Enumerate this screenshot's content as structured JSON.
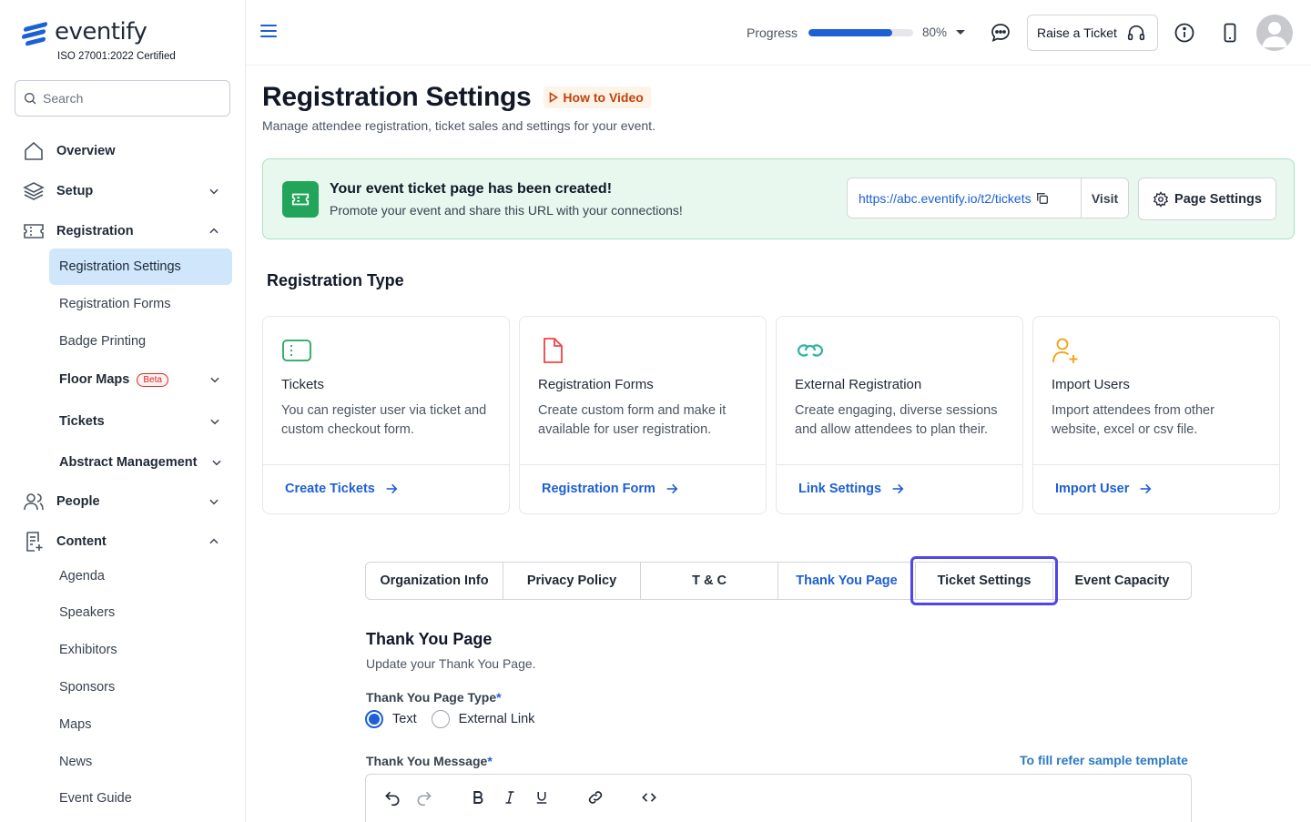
{
  "app": {
    "logo_text": "eventify",
    "certification": "ISO 27001:2022 Certified"
  },
  "search": {
    "placeholder": "Search"
  },
  "sidebar": {
    "items": [
      {
        "label": "Overview",
        "icon": "home-icon"
      },
      {
        "label": "Setup",
        "icon": "layers-icon",
        "expanded": false
      },
      {
        "label": "Registration",
        "icon": "ticket-icon",
        "expanded": true
      },
      {
        "label": "People",
        "icon": "users-icon",
        "expanded": false
      },
      {
        "label": "Content",
        "icon": "document-icon",
        "expanded": true
      }
    ],
    "registration_sub": [
      {
        "label": "Registration Settings",
        "active": true
      },
      {
        "label": "Registration Forms"
      },
      {
        "label": "Badge Printing"
      },
      {
        "label": "Floor Maps",
        "badge": "Beta"
      },
      {
        "label": "Tickets"
      },
      {
        "label": "Abstract Management"
      }
    ],
    "content_sub": [
      {
        "label": "Agenda"
      },
      {
        "label": "Speakers"
      },
      {
        "label": "Exhibitors"
      },
      {
        "label": "Sponsors"
      },
      {
        "label": "Maps"
      },
      {
        "label": "News"
      },
      {
        "label": "Event Guide"
      }
    ]
  },
  "header": {
    "progress_label": "Progress",
    "progress_value": 0.8,
    "progress_text": "80%",
    "raise_ticket_label": "Raise a Ticket"
  },
  "page": {
    "title": "Registration Settings",
    "how_to_video": "How to Video",
    "subtitle": "Manage attendee registration, ticket sales and settings for your event."
  },
  "banner": {
    "title": "Your event ticket page has been created!",
    "subtitle": "Promote your event and share this URL with your connections!",
    "url": "https://abc.eventify.io/t2/tickets",
    "visit_label": "Visit",
    "page_settings_label": "Page Settings"
  },
  "registration_type": {
    "title": "Registration Type",
    "cards": [
      {
        "title": "Tickets",
        "description": "You can register user via ticket and custom checkout form.",
        "link": "Create Tickets",
        "icon": "ticket-icon"
      },
      {
        "title": "Registration Forms",
        "description": "Create custom form and make it available for user registration.",
        "link": "Registration Form",
        "icon": "file-icon"
      },
      {
        "title": "External Registration",
        "description": "Create engaging, diverse sessions and allow attendees to plan their.",
        "link": "Link Settings",
        "icon": "link-icon"
      },
      {
        "title": "Import Users",
        "description": "Import attendees from other website, excel or csv file.",
        "link": "Import User",
        "icon": "user-plus-icon"
      }
    ]
  },
  "tabs": [
    {
      "label": "Organization Info"
    },
    {
      "label": "Privacy Policy"
    },
    {
      "label": "T & C"
    },
    {
      "label": "Thank You Page",
      "active": true
    },
    {
      "label": "Ticket Settings",
      "focused": true
    },
    {
      "label": "Event Capacity"
    }
  ],
  "thank_you": {
    "title": "Thank You Page",
    "subtitle": "Update your Thank You Page.",
    "type_label": "Thank You Page Type",
    "required_mark": "*",
    "options": [
      "Text",
      "External Link"
    ],
    "selected": "Text",
    "message_label": "Thank You Message",
    "fill_refer": "To fill refer sample template"
  },
  "colors": {
    "accent": "#1d5fd6",
    "success": "#22a55b",
    "banner_bg": "#e8f8ef",
    "active_nav": "#cfe6fb",
    "focus_ring": "#4f46e5"
  }
}
